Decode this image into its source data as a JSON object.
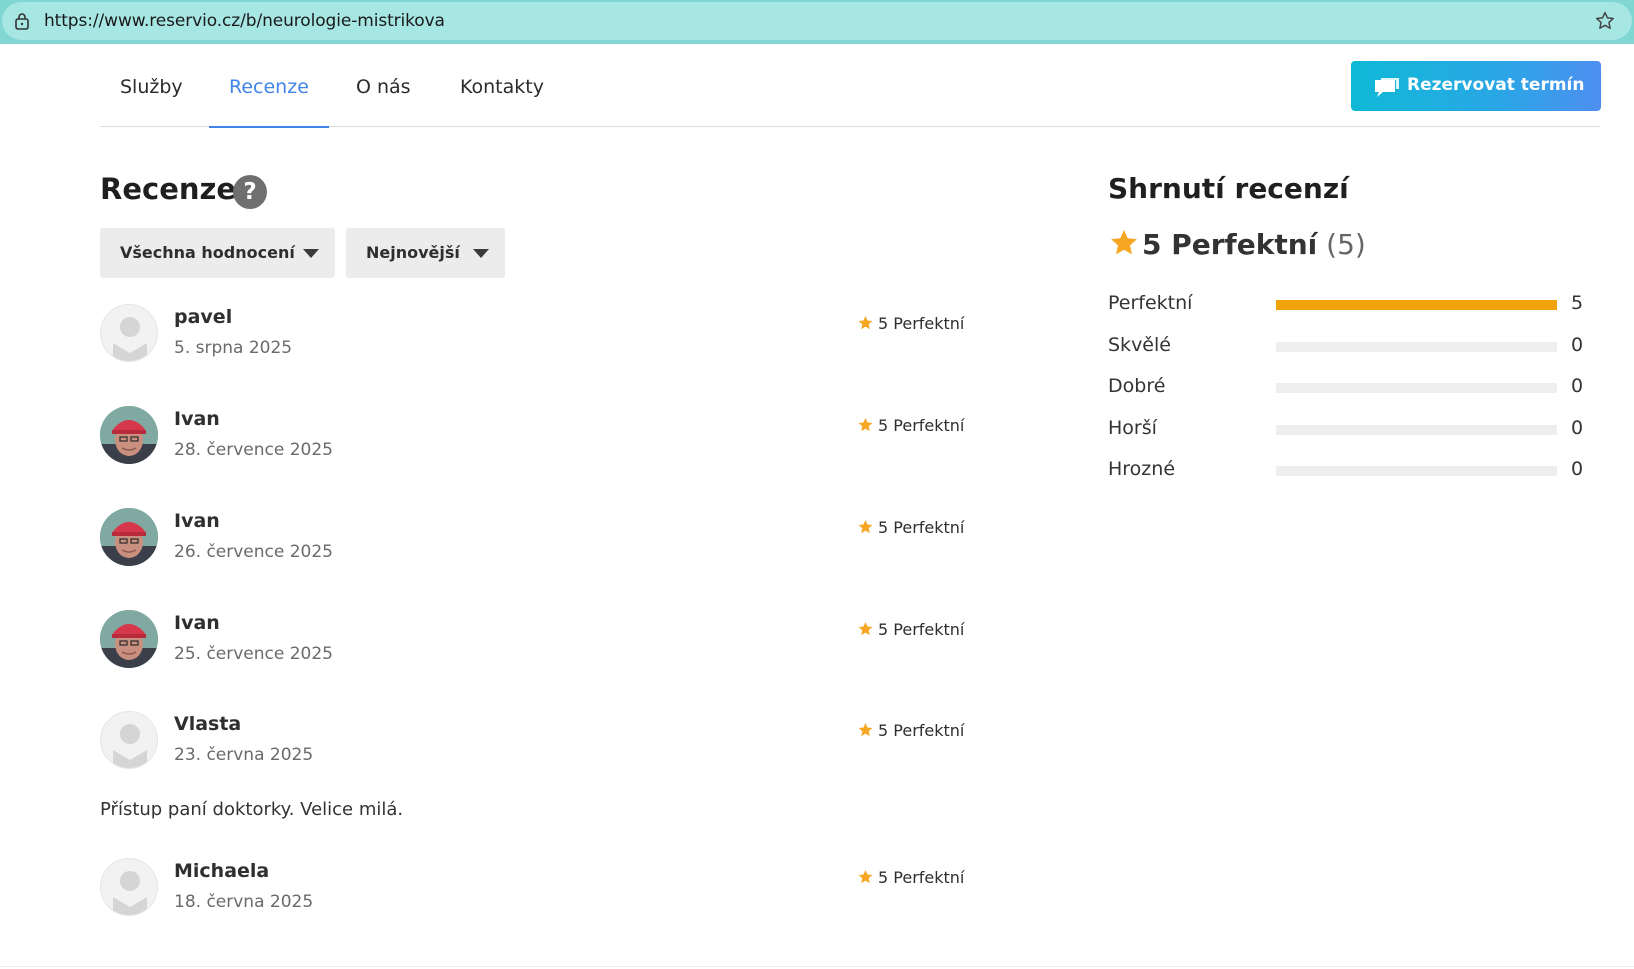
{
  "browser": {
    "url": "https://www.reservio.cz/b/neurologie-mistrikova"
  },
  "nav": {
    "tabs": [
      {
        "label": "Služby",
        "active": false
      },
      {
        "label": "Recenze",
        "active": true
      },
      {
        "label": "O nás",
        "active": false
      },
      {
        "label": "Kontakty",
        "active": false
      }
    ],
    "book_label": "Rezervovat termín"
  },
  "reviews": {
    "title": "Recenze",
    "filters": {
      "rating_filter": "Všechna hodnocení",
      "sort": "Nejnovější"
    },
    "items": [
      {
        "name": "pavel",
        "date": "5. srpna 2025",
        "rating": "5 Perfektní",
        "avatar": "default",
        "text": ""
      },
      {
        "name": "Ivan",
        "date": "28. července 2025",
        "rating": "5 Perfektní",
        "avatar": "photo",
        "text": ""
      },
      {
        "name": "Ivan",
        "date": "26. července 2025",
        "rating": "5 Perfektní",
        "avatar": "photo",
        "text": ""
      },
      {
        "name": "Ivan",
        "date": "25. července 2025",
        "rating": "5 Perfektní",
        "avatar": "photo",
        "text": ""
      },
      {
        "name": "Vlasta",
        "date": "23. června 2025",
        "rating": "5 Perfektní",
        "avatar": "default",
        "text": "Přístup paní doktorky. Velice milá."
      },
      {
        "name": "Michaela",
        "date": "18. června 2025",
        "rating": "5 Perfektní",
        "avatar": "default",
        "text": ""
      }
    ]
  },
  "summary": {
    "title": "Shrnutí recenzí",
    "score_label": "5 Perfektní",
    "score_count": "(5)",
    "bars": [
      {
        "label": "Perfektní",
        "count": "5",
        "fraction": 1.0
      },
      {
        "label": "Skvělé",
        "count": "0",
        "fraction": 0
      },
      {
        "label": "Dobré",
        "count": "0",
        "fraction": 0
      },
      {
        "label": "Horší",
        "count": "0",
        "fraction": 0
      },
      {
        "label": "Hrozné",
        "count": "0",
        "fraction": 0
      }
    ]
  },
  "colors": {
    "accent": "#3f86e8",
    "star": "#f5a623",
    "bar_fill": "#f0a30a",
    "book_button_start": "#0fb9d6",
    "book_button_end": "#4e8ff0"
  }
}
